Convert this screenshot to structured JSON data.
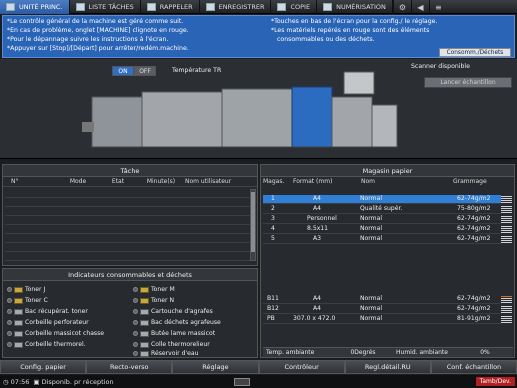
{
  "tabs": [
    {
      "label": "UNITÉ PRINC.",
      "active": true,
      "icon": "printer-icon"
    },
    {
      "label": "LISTE TÂCHES",
      "active": false,
      "icon": "list-icon"
    },
    {
      "label": "RAPPELER",
      "active": false,
      "icon": "recall-icon"
    },
    {
      "label": "ENREGISTRER",
      "active": false,
      "icon": "save-icon"
    },
    {
      "label": "COPIE",
      "active": false,
      "icon": "copy-icon"
    },
    {
      "label": "NUMÉRISATION",
      "active": false,
      "icon": "scan-icon"
    }
  ],
  "messages": {
    "left": [
      "*Le contrôle général de la machine est géré comme suit.",
      "*En cas de problème, onglet [MACHINE] clignote en rouge.",
      "*Pour le dépannage suivre les instructions à l'écran.",
      "*Appuyer sur [Stop]/[Départ] pour arrêter/redém.machine."
    ],
    "right": [
      "*Touches en bas de l'écran pour la config./ le réglage.",
      "*Les matériels repérés en rouge sont des éléments",
      "consommables ou des déchets."
    ],
    "consom_button": "Consomm./Déchets"
  },
  "machine": {
    "on_label": "ON",
    "off_label": "OFF",
    "temp_label": "Température TR",
    "scanner_status": "Scanner disponible",
    "lancer_button": "Lancer échantillon"
  },
  "tache": {
    "title": "Tâche",
    "columns": [
      "N°",
      "Mode",
      "Etat",
      "Minute(s)",
      "Nom utilisateur"
    ]
  },
  "indicateurs": {
    "title": "Indicateurs consommables et déchets",
    "left": [
      "Toner J",
      "Toner C",
      "Bac récupérat. toner",
      "Corbeille perforateur",
      "Corbeille massicot chasse",
      "Corbeille thermorel."
    ],
    "right": [
      "Toner M",
      "Toner N",
      "Cartouche d'agrafes",
      "Bac déchets agrafeuse",
      "Butée lame massicot",
      "Colle thermorelieur",
      "Réservoir d'eau"
    ]
  },
  "magasin": {
    "title": "Magasin papier",
    "columns": [
      "Magas.",
      "Format (mm)",
      "Nom",
      "Grammage"
    ],
    "rows": [
      {
        "mag": "1",
        "format": "A4",
        "nom": "Normal",
        "gram": "62-74g/m2",
        "selected": true
      },
      {
        "mag": "2",
        "format": "A4",
        "nom": "Qualité supér.",
        "gram": "75-80g/m2",
        "selected": false
      },
      {
        "mag": "3",
        "format": "Personnel",
        "nom": "Normal",
        "gram": "62-74g/m2",
        "selected": false
      },
      {
        "mag": "4",
        "format": "8.5x11",
        "nom": "Normal",
        "gram": "62-74g/m2",
        "selected": false
      },
      {
        "mag": "5",
        "format": "A3",
        "nom": "Normal",
        "gram": "62-74g/m2",
        "selected": false
      },
      {
        "mag": "B11",
        "format": "A4",
        "nom": "Normal",
        "gram": "62-74g/m2",
        "selected": false
      },
      {
        "mag": "B12",
        "format": "A4",
        "nom": "Normal",
        "gram": "62-74g/m2",
        "selected": false
      },
      {
        "mag": "PB",
        "format": "307.0 x 472.0",
        "nom": "Normal",
        "gram": "81-91g/m2",
        "selected": false
      }
    ],
    "temp_label": "Temp. ambiante",
    "temp_value": "0Degrés",
    "humid_label": "Humid. ambiante",
    "humid_value": "0%"
  },
  "bottom_buttons": [
    "Config. papier",
    "Recto-verso",
    "Réglage",
    "Contrôleur",
    "Regl.détail.RU",
    "Conf. échantillon"
  ],
  "status": {
    "time": "07:56",
    "message": "Disponib. pr réception",
    "alert": "Tamb/Dev."
  },
  "colors": {
    "accent": "#2f7fd6",
    "message_bg": "#2a64b6",
    "alert": "#b02020"
  }
}
